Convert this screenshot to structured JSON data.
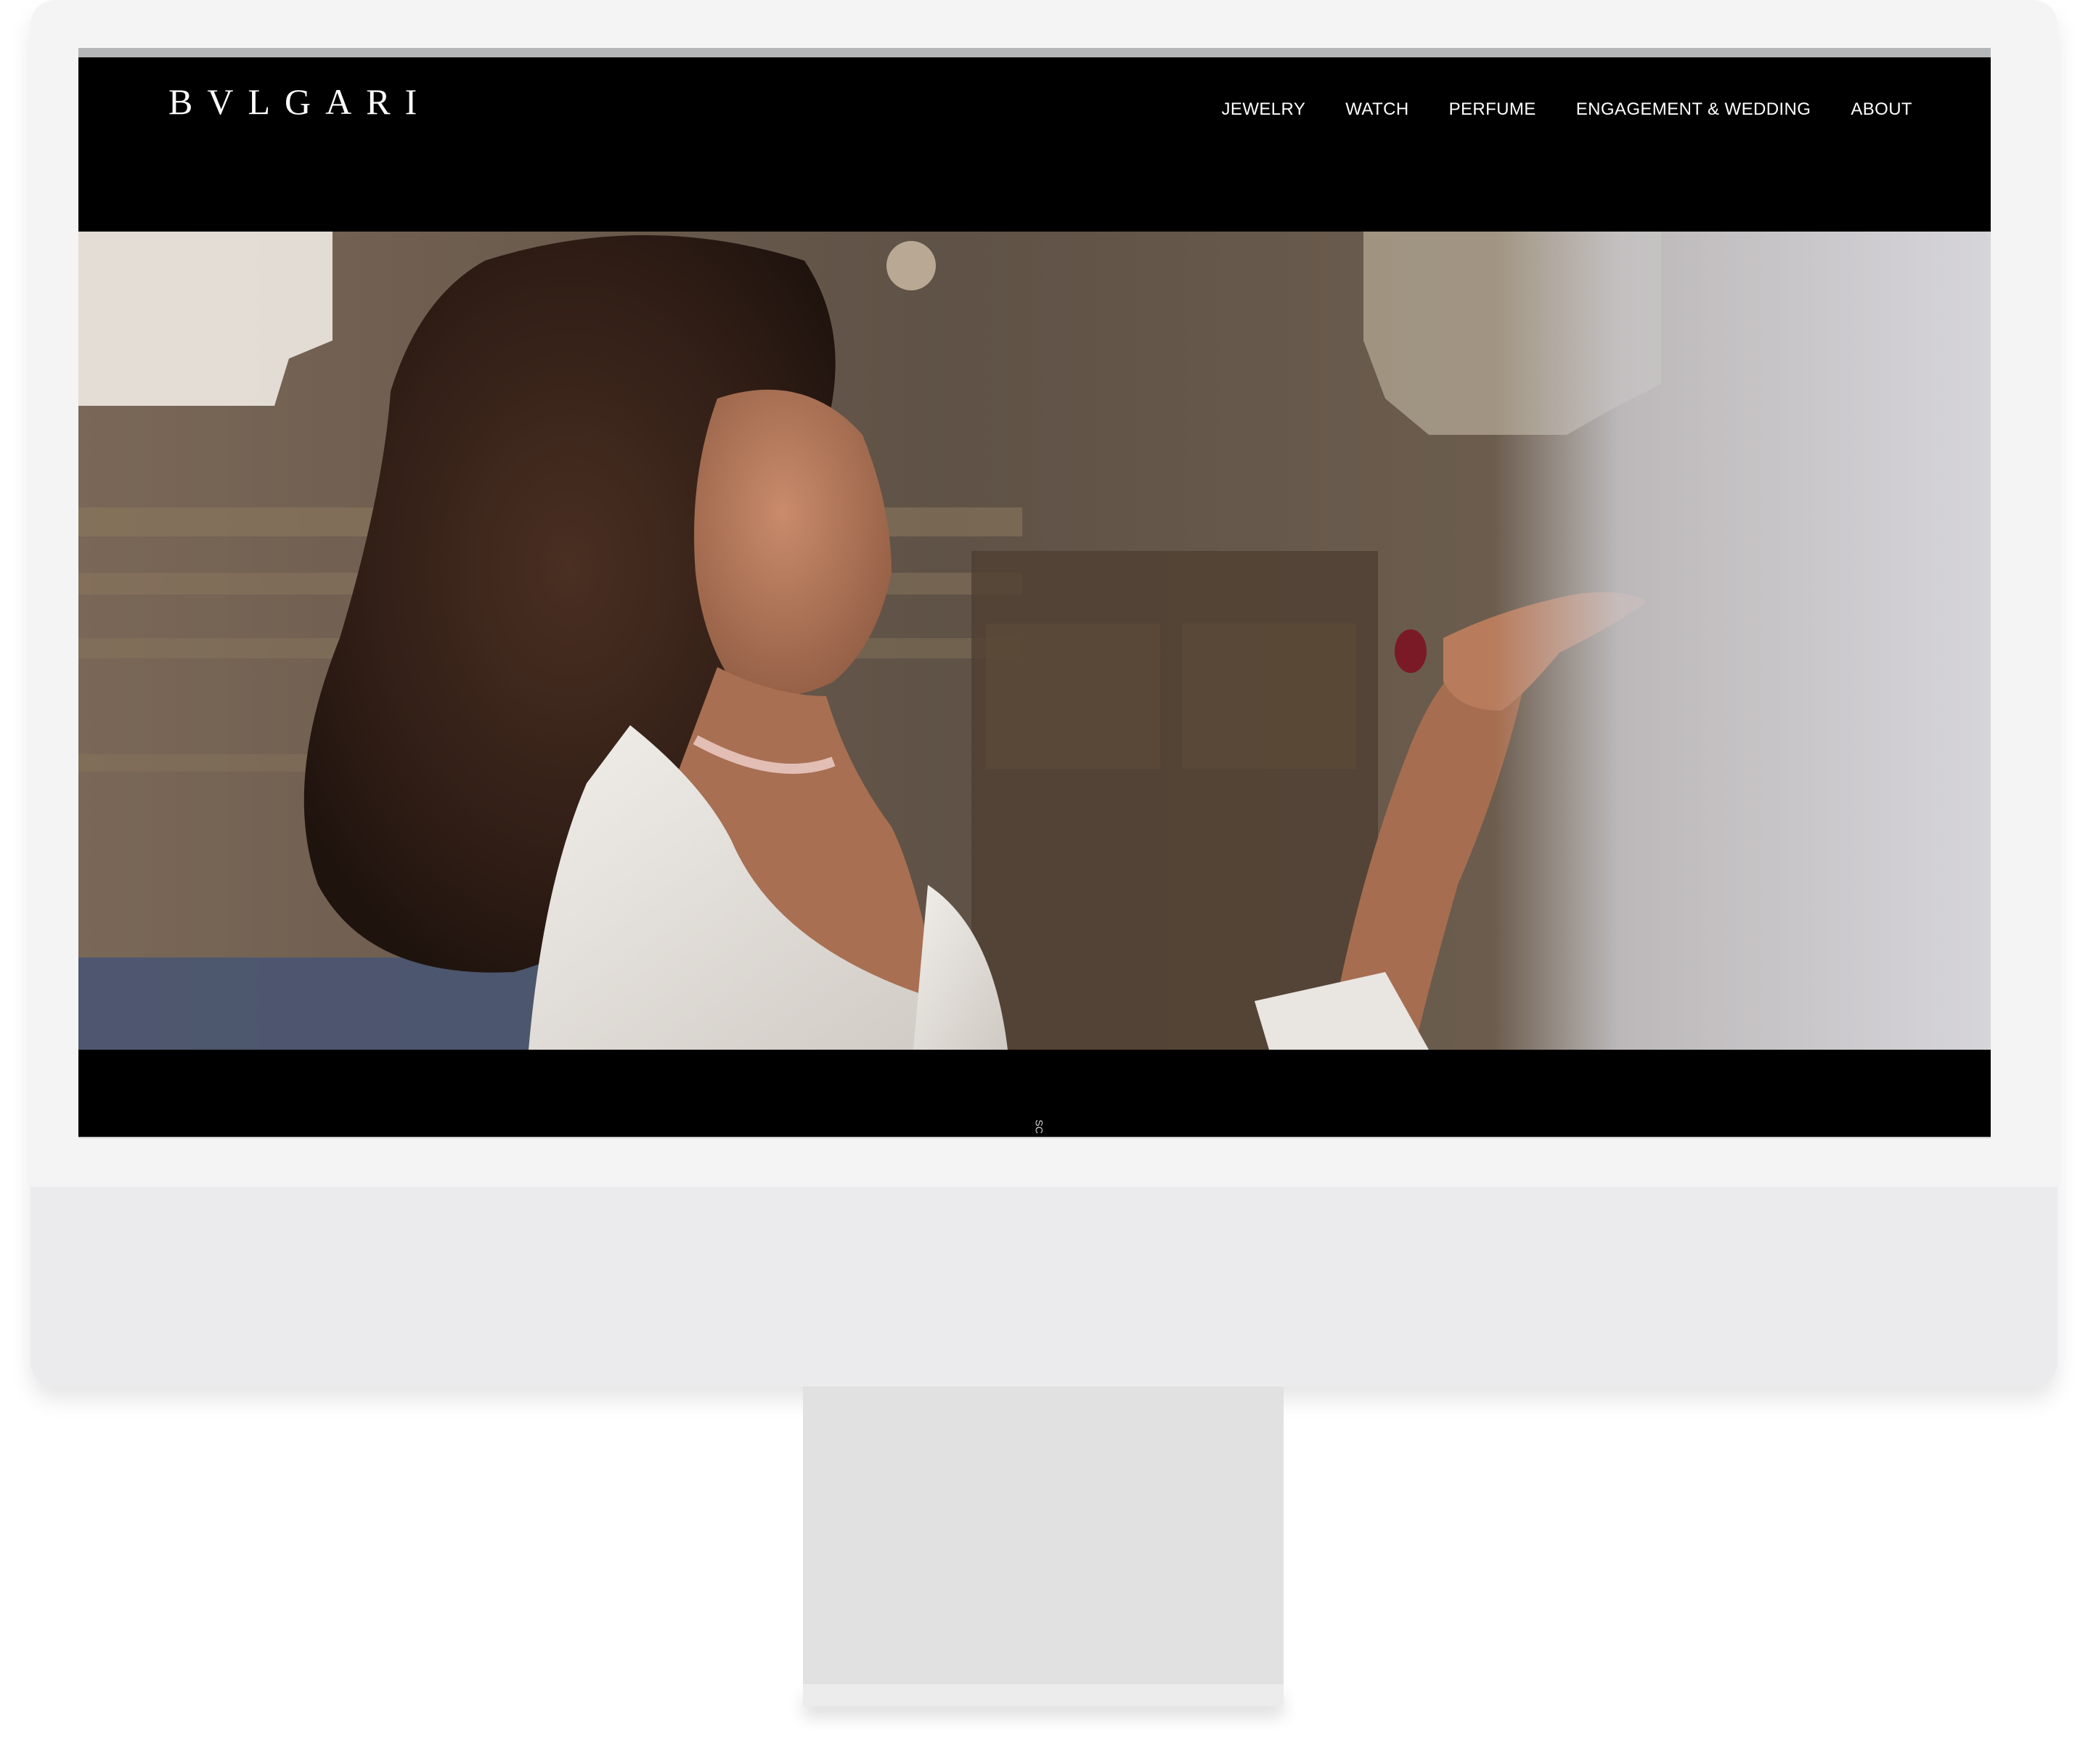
{
  "brand": {
    "logo_text": "BVLGARI"
  },
  "nav": {
    "items": [
      {
        "label": "JEWELRY"
      },
      {
        "label": "WATCH"
      },
      {
        "label": "PERFUME"
      },
      {
        "label": "ENGAGEMENT & WEDDING"
      },
      {
        "label": "ABOUT"
      }
    ]
  },
  "hero": {
    "scroll_hint": "SC"
  },
  "colors": {
    "header_bg": "#000000",
    "nav_text": "#ffffff",
    "monitor_bezel": "#f4f4f4",
    "monitor_chin": "#ebebed",
    "stand": "#e1e1e1"
  }
}
